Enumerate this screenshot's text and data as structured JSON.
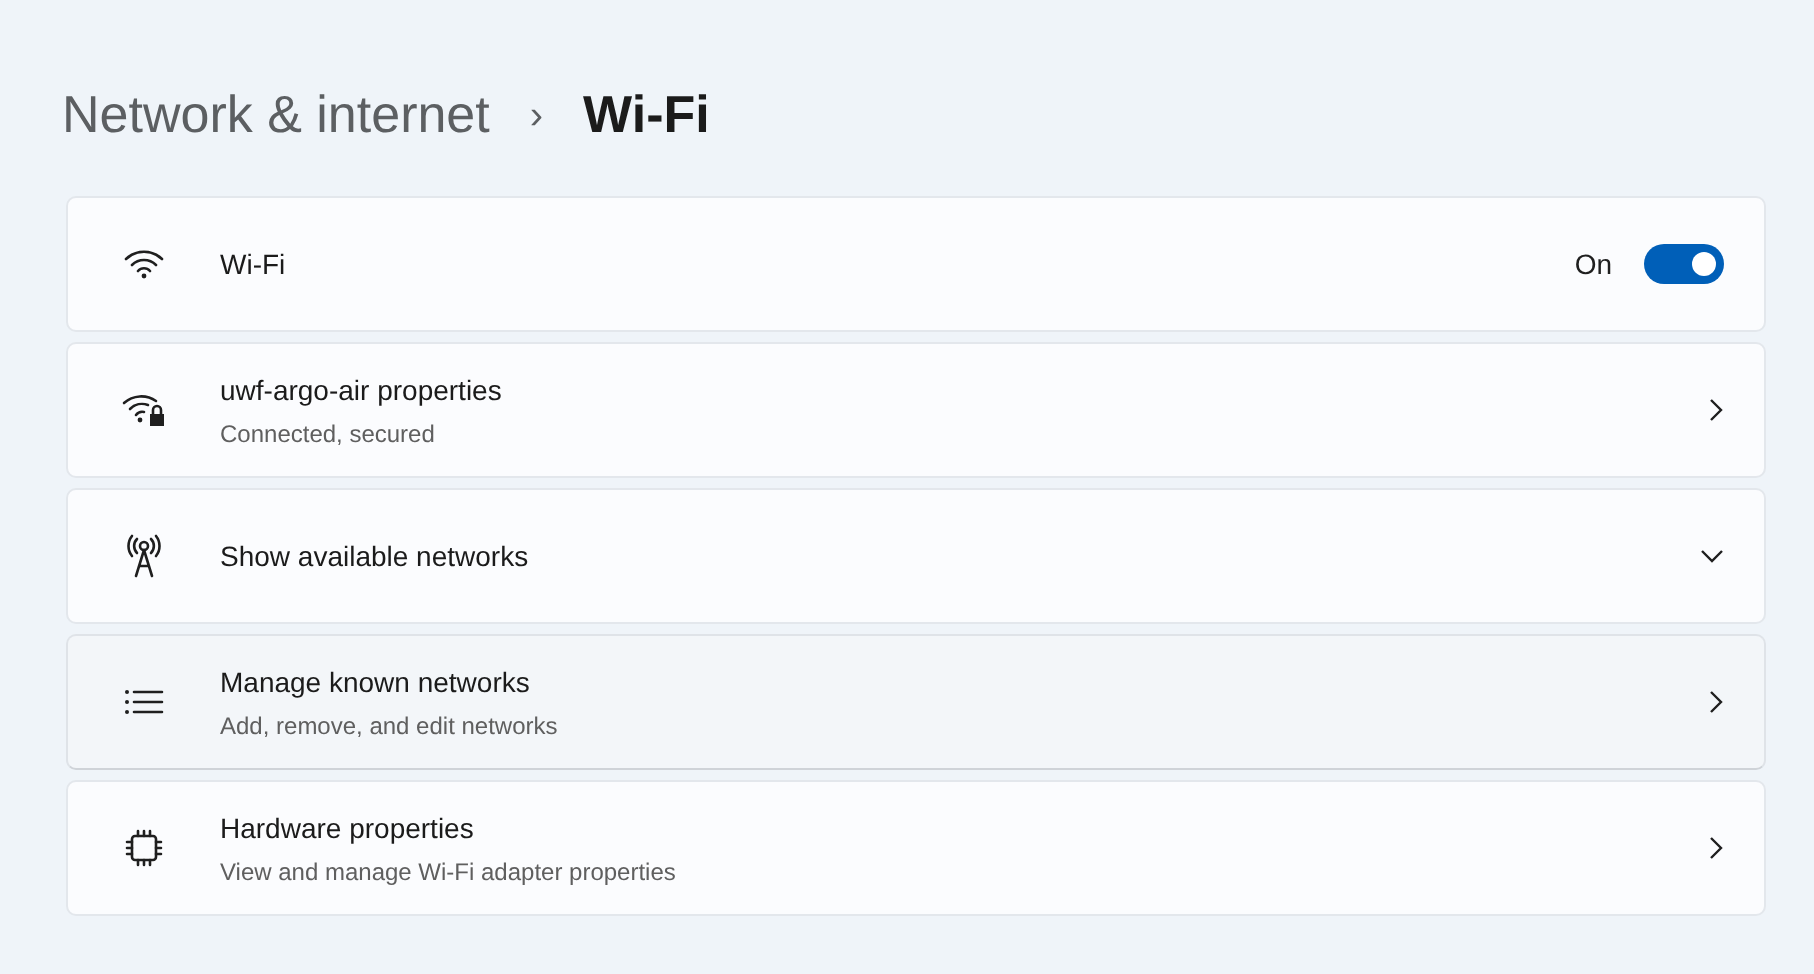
{
  "breadcrumb": {
    "parent": "Network & internet",
    "separator": "›",
    "current": "Wi-Fi"
  },
  "settings": [
    {
      "kind": "toggle",
      "title": "Wi-Fi",
      "state_label": "On",
      "on": true,
      "hovered": false
    },
    {
      "kind": "link",
      "title": "uwf-argo-air properties",
      "subtitle": "Connected, secured",
      "hovered": false
    },
    {
      "kind": "expand",
      "title": "Show available networks",
      "expanded": false,
      "hovered": false
    },
    {
      "kind": "link",
      "title": "Manage known networks",
      "subtitle": "Add, remove, and edit networks",
      "hovered": true
    },
    {
      "kind": "link",
      "title": "Hardware properties",
      "subtitle": "View and manage Wi-Fi adapter properties",
      "hovered": false
    }
  ]
}
